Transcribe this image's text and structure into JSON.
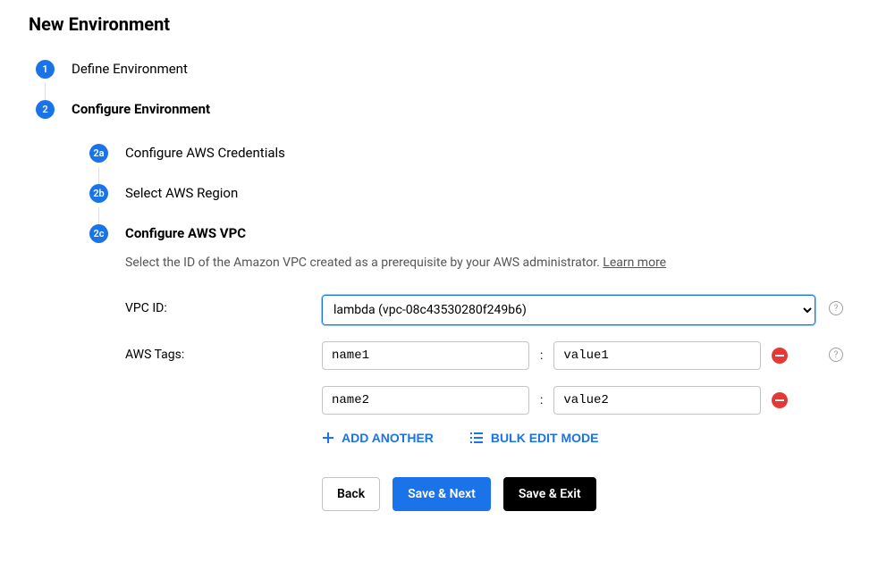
{
  "page_title": "New Environment",
  "steps": {
    "s1": {
      "badge": "1",
      "title": "Define Environment"
    },
    "s2": {
      "badge": "2",
      "title": "Configure Environment",
      "sub_a": {
        "badge": "2a",
        "title": "Configure AWS Credentials"
      },
      "sub_b": {
        "badge": "2b",
        "title": "Select AWS Region"
      },
      "sub_c": {
        "badge": "2c",
        "title": "Configure AWS VPC",
        "desc": "Select the ID of the Amazon VPC created as a prerequisite by your AWS administrator. ",
        "learn_more": "Learn more"
      }
    }
  },
  "form": {
    "vpc_label": "VPC ID:",
    "vpc_selected": "lambda (vpc-08c43530280f249b6)",
    "tags_label": "AWS Tags:",
    "tags": [
      {
        "name": "name1",
        "value": "value1"
      },
      {
        "name": "name2",
        "value": "value2"
      }
    ],
    "add_another": "ADD ANOTHER",
    "bulk_edit": "BULK EDIT MODE"
  },
  "buttons": {
    "back": "Back",
    "save_next": "Save & Next",
    "save_exit": "Save & Exit"
  }
}
